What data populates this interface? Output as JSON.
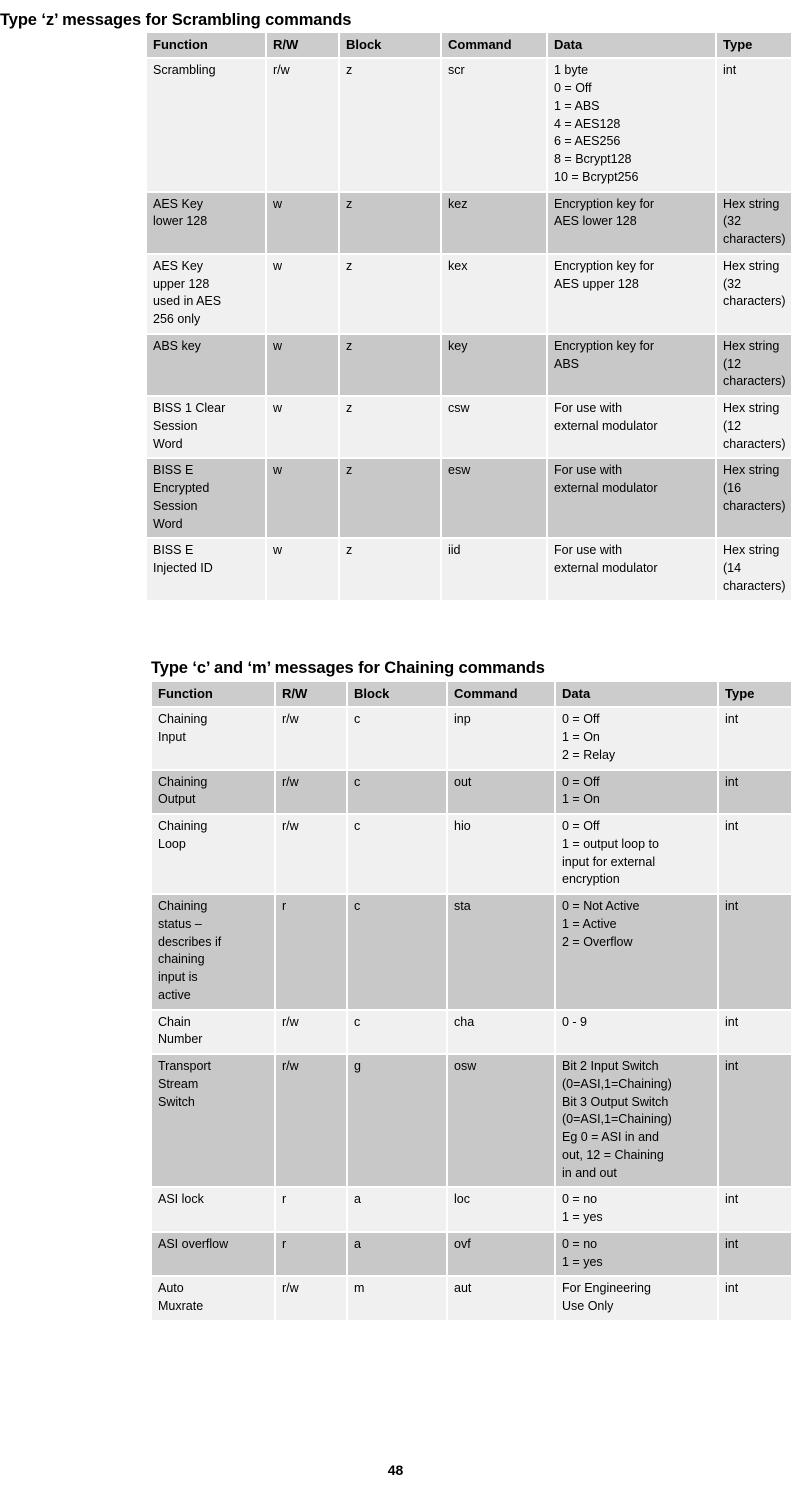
{
  "page": {
    "number": "48"
  },
  "sections": [
    {
      "title": "Type ‘z’ messages for Scrambling commands",
      "table": {
        "headers": [
          "Function",
          "R/W",
          "Block",
          "Command",
          "Data",
          "Type"
        ],
        "rows": [
          {
            "function": "Scrambling",
            "rw": "r/w",
            "block": "z",
            "command": "scr",
            "data": "1 byte\n0 = Off\n1 = ABS\n4 = AES128\n6 = AES256\n8 = Bcrypt128\n10 = Bcrypt256",
            "type": "int"
          },
          {
            "function": "AES Key\nlower 128",
            "rw": "w",
            "block": "z",
            "command": "kez",
            "data": "Encryption key for\nAES lower 128",
            "type": "Hex string\n(32\ncharacters)"
          },
          {
            "function": "AES Key\nupper 128\nused in AES\n256 only",
            "rw": "w",
            "block": "z",
            "command": "kex",
            "data": "Encryption key for\nAES upper 128",
            "type": "Hex string\n(32\ncharacters)"
          },
          {
            "function": "ABS key",
            "rw": "w",
            "block": "z",
            "command": "key",
            "data": "Encryption key for\nABS",
            "type": "Hex string\n(12\ncharacters)"
          },
          {
            "function": "BISS 1 Clear\nSession\nWord",
            "rw": "w",
            "block": "z",
            "command": "csw",
            "data": "For use with\nexternal modulator",
            "type": "Hex string\n(12\ncharacters)"
          },
          {
            "function": "BISS E\nEncrypted\nSession\nWord",
            "rw": "w",
            "block": "z",
            "command": "esw",
            "data": "For use with\nexternal modulator",
            "type": "Hex string\n(16\ncharacters)"
          },
          {
            "function": "BISS E\nInjected ID",
            "rw": "w",
            "block": "z",
            "command": "iid",
            "data": "For use with\nexternal modulator",
            "type": "Hex string\n(14\ncharacters)"
          }
        ]
      }
    },
    {
      "title": "Type ‘c’ and ‘m’ messages for Chaining commands",
      "table": {
        "headers": [
          "Function",
          "R/W",
          "Block",
          "Command",
          "Data",
          "Type"
        ],
        "rows": [
          {
            "function": "Chaining\nInput",
            "rw": "r/w",
            "block": "c",
            "command": "inp",
            "data": "0 = Off\n1 = On\n2 = Relay",
            "type": "int"
          },
          {
            "function": "Chaining\nOutput",
            "rw": "r/w",
            "block": "c",
            "command": "out",
            "data": "0 = Off\n1 = On",
            "type": "int"
          },
          {
            "function": "Chaining\nLoop",
            "rw": "r/w",
            "block": "c",
            "command": "hio",
            "data": "0 = Off\n1 = output loop to\ninput for external\nencryption",
            "type": "int"
          },
          {
            "function": "Chaining\nstatus –\ndescribes if\nchaining\ninput is\nactive",
            "rw": "r",
            "block": "c",
            "command": "sta",
            "data": "0 = Not Active\n1 = Active\n2 = Overflow",
            "type": "int"
          },
          {
            "function": "Chain\nNumber",
            "rw": "r/w",
            "block": "c",
            "command": "cha",
            "data": "0 - 9",
            "type": "int"
          },
          {
            "function": "Transport\nStream\nSwitch",
            "rw": "r/w",
            "block": "g",
            "command": "osw",
            "data": "Bit 2 Input Switch\n(0=ASI,1=Chaining)\nBit 3 Output Switch\n(0=ASI,1=Chaining)\nEg 0 = ASI in and\nout, 12 = Chaining\nin and out",
            "type": "int"
          },
          {
            "function": "ASI lock",
            "rw": "r",
            "block": "a",
            "command": "loc",
            "data": "0 = no\n1 = yes",
            "type": "int"
          },
          {
            "function": "ASI overflow",
            "rw": "r",
            "block": "a",
            "command": "ovf",
            "data": "0 = no\n1 = yes",
            "type": "int"
          },
          {
            "function": "Auto\nMuxrate",
            "rw": "r/w",
            "block": "m",
            "command": "aut",
            "data": "For Engineering\nUse Only",
            "type": "int"
          }
        ]
      }
    }
  ],
  "colors": {
    "header_bg": "#cccccc",
    "row_dark_bg": "#c8c8c8",
    "row_light_bg": "#f0f0f0",
    "text": "#000000",
    "page_bg": "#ffffff"
  }
}
